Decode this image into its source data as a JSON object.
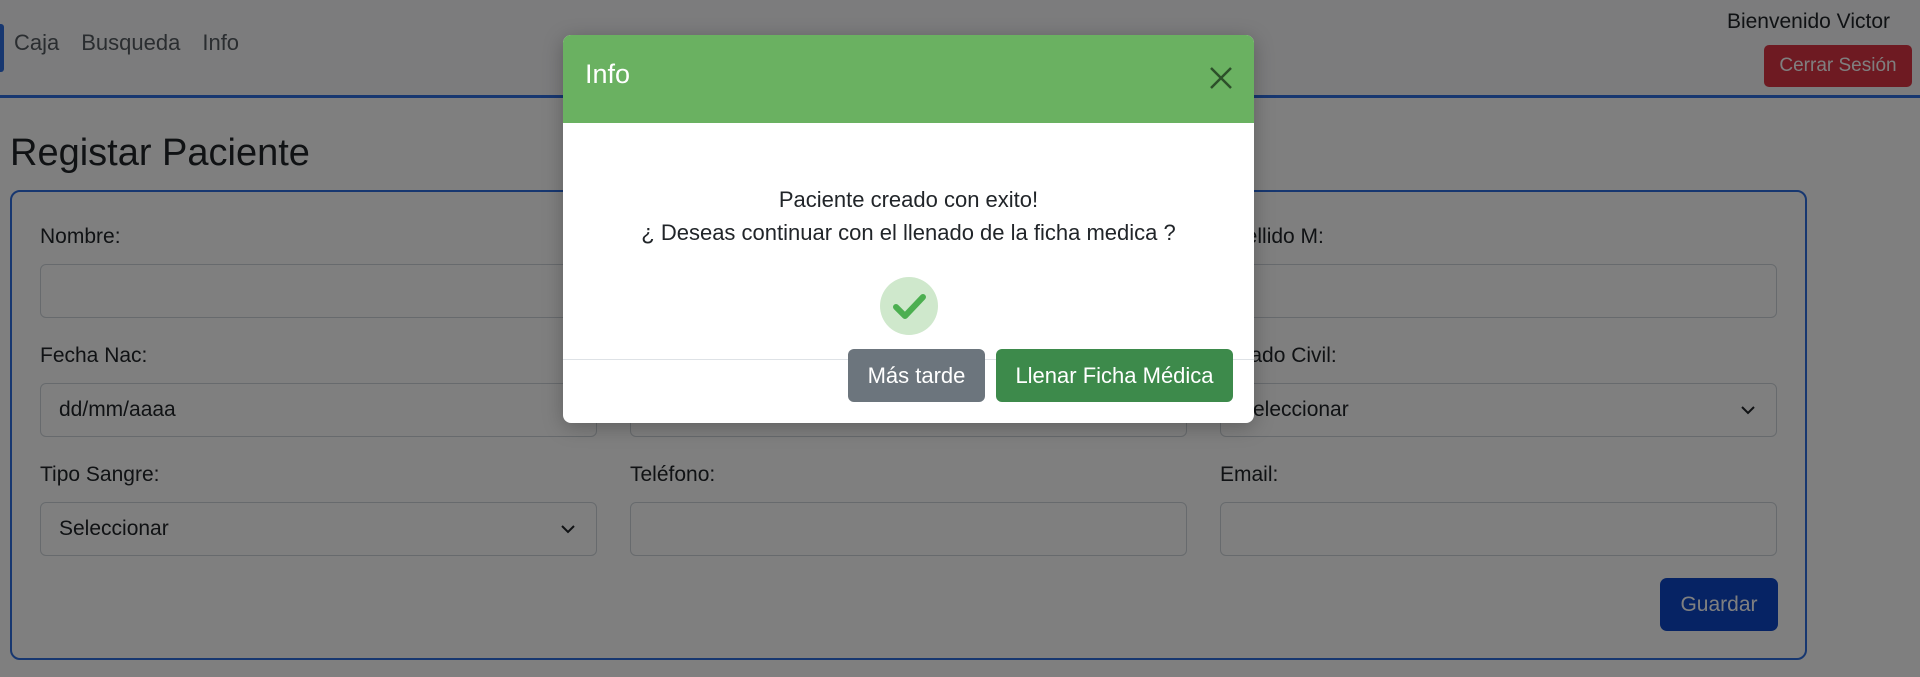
{
  "navbar": {
    "links": [
      "Caja",
      "Busqueda",
      "Info"
    ],
    "welcome": "Bienvenido Victor",
    "logout_label": "Cerrar Sesión"
  },
  "page": {
    "title": "Registar Paciente"
  },
  "form": {
    "nombre_label": "Nombre:",
    "apellido_m_label": "Apellido M:",
    "fecha_nac_label": "Fecha Nac:",
    "fecha_nac_value": "dd/mm/aaaa",
    "estado_civil_label": "Estado Civil:",
    "estado_civil_value": "Seleccionar",
    "tipo_sangre_label": "Tipo Sangre:",
    "tipo_sangre_value": "Seleccionar",
    "telefono_label": "Teléfono:",
    "email_label": "Email:",
    "save_label": "Guardar"
  },
  "modal": {
    "title": "Info",
    "message_line1": "Paciente creado con exito!",
    "message_line2": "¿ Deseas continuar con el llenado de la ficha medica ?",
    "later_label": "Más tarde",
    "fill_label": "Llenar Ficha Médica"
  },
  "colors": {
    "accent": "#2f6fe0",
    "modal_header": "#6ab161",
    "danger": "#dc3545",
    "success_button": "#3d8a4b",
    "secondary_button": "#6c757d",
    "primary_button": "#0d47c9"
  }
}
